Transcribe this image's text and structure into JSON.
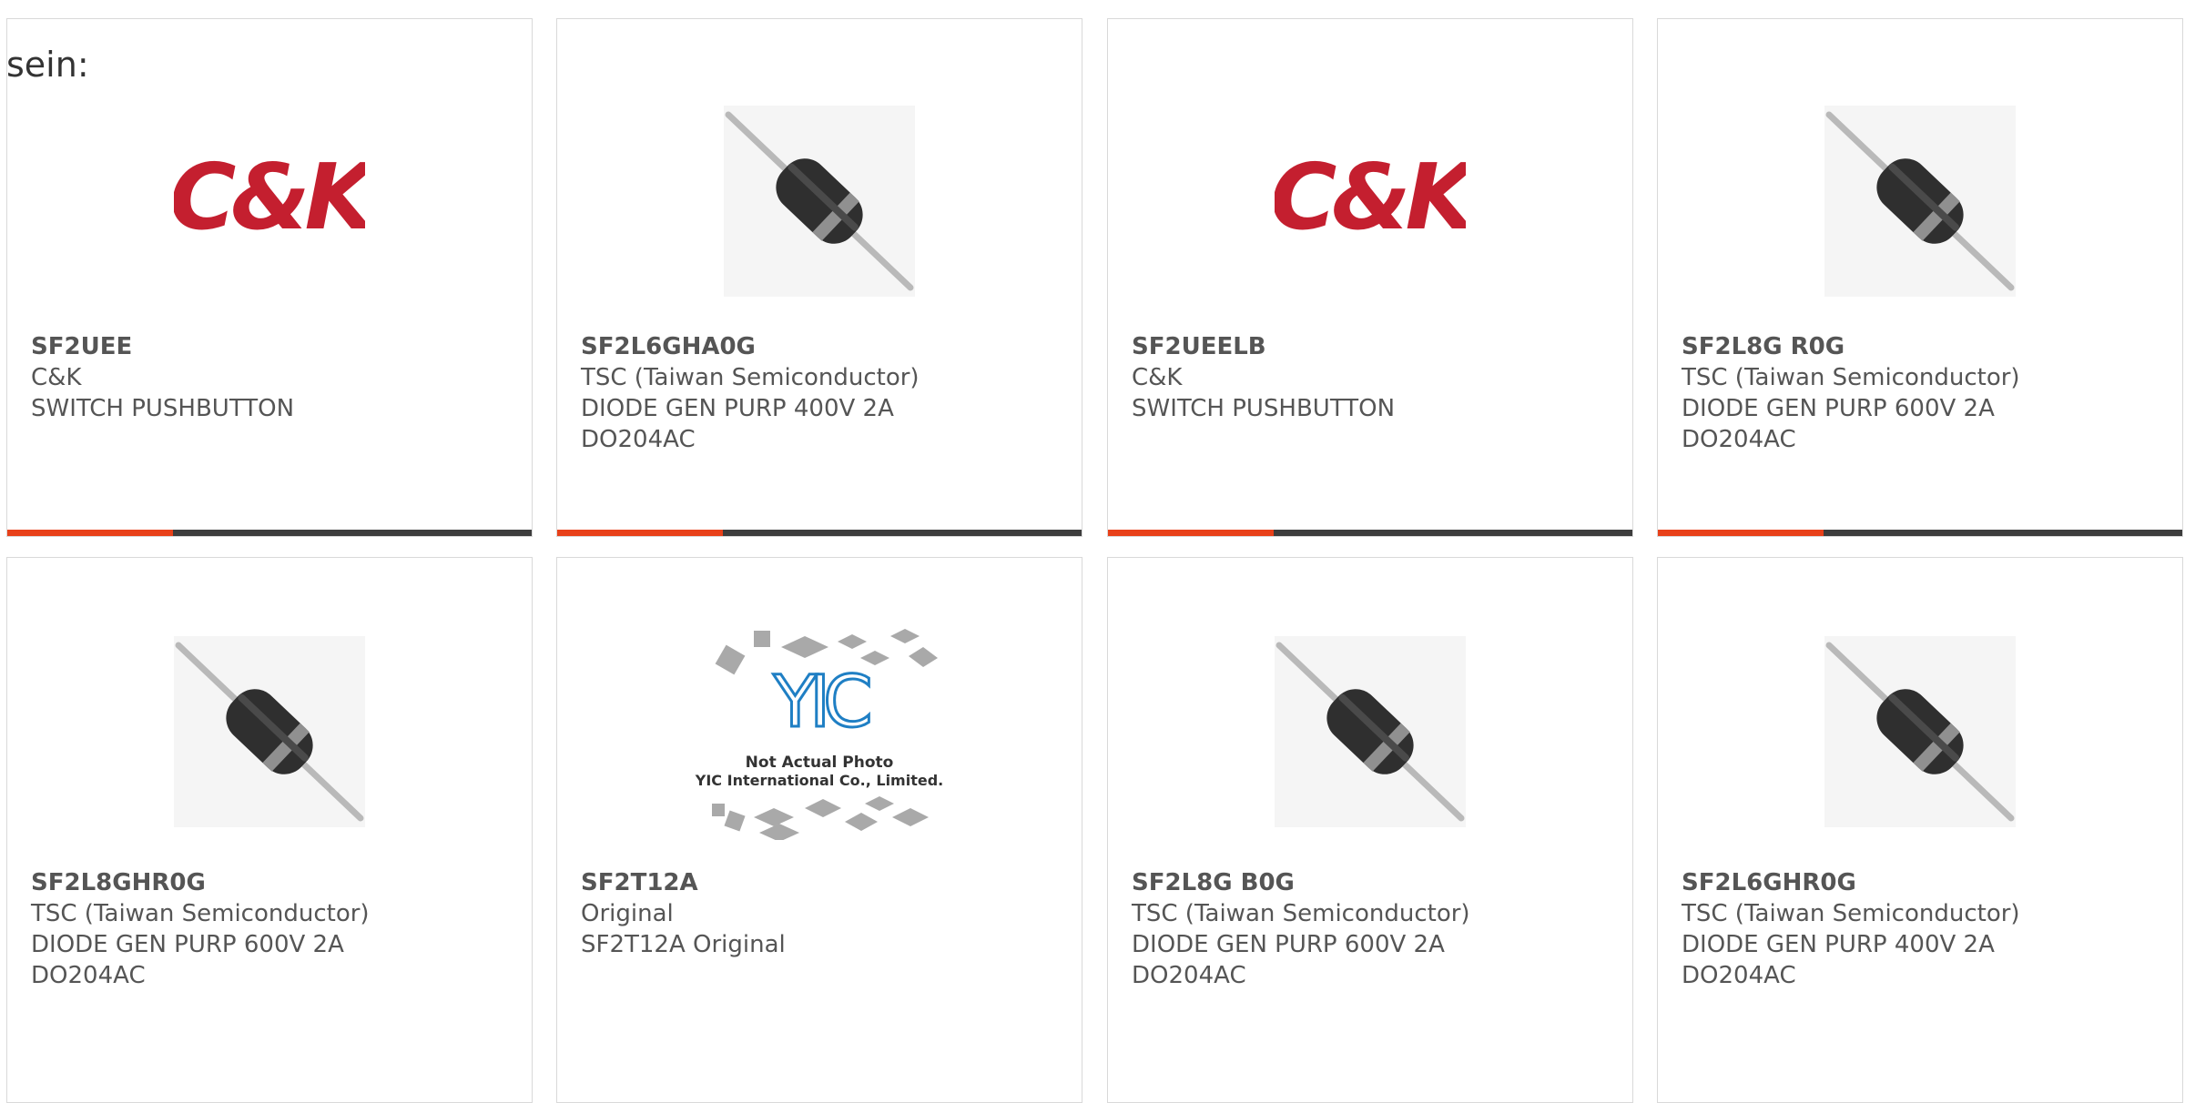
{
  "lead_text": "sein:",
  "colors": {
    "accent": "#e8411a",
    "bar": "#3d3d3d",
    "border": "#d9d9d9",
    "brand_red": "#c41f2f"
  },
  "photo_placeholder": {
    "line1": "Not Actual Photo",
    "line2": "YIC International Co., Limited.",
    "logo": "YIC"
  },
  "products": [
    {
      "part": "SF2UEE",
      "maker": "C&K",
      "desc": "SWITCH PUSHBUTTON",
      "image": "ck-logo"
    },
    {
      "part": "SF2L6GHA0G",
      "maker": "TSC (Taiwan Semiconductor)",
      "desc": "DIODE GEN PURP 400V 2A",
      "desc2": "DO204AC",
      "image": "diode-icon"
    },
    {
      "part": "SF2UEELB",
      "maker": "C&K",
      "desc": "SWITCH PUSHBUTTON",
      "image": "ck-logo"
    },
    {
      "part": "SF2L8G R0G",
      "maker": "TSC (Taiwan Semiconductor)",
      "desc": "DIODE GEN PURP 600V 2A",
      "desc2": "DO204AC",
      "image": "diode-icon"
    },
    {
      "part": "SF2L8GHR0G",
      "maker": "TSC (Taiwan Semiconductor)",
      "desc": "DIODE GEN PURP 600V 2A",
      "desc2": "DO204AC",
      "image": "diode-icon"
    },
    {
      "part": "SF2T12A",
      "maker": "Original",
      "desc": "SF2T12A Original",
      "image": "not-actual-photo"
    },
    {
      "part": "SF2L8G B0G",
      "maker": "TSC (Taiwan Semiconductor)",
      "desc": "DIODE GEN PURP 600V 2A",
      "desc2": "DO204AC",
      "image": "diode-icon"
    },
    {
      "part": "SF2L6GHR0G",
      "maker": "TSC (Taiwan Semiconductor)",
      "desc": "DIODE GEN PURP 400V 2A",
      "desc2": "DO204AC",
      "image": "diode-icon"
    }
  ]
}
